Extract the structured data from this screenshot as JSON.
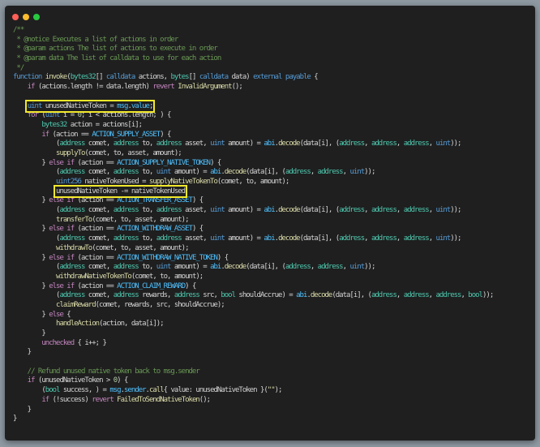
{
  "window": {
    "controls": [
      {
        "name": "close",
        "color": "#ff5f57"
      },
      {
        "name": "minimize",
        "color": "#febc2e"
      },
      {
        "name": "zoom",
        "color": "#28c840"
      }
    ]
  },
  "highlight_color": "#f2e82c",
  "lines": [
    {
      "tokens": [
        [
          "/**",
          "c"
        ]
      ]
    },
    {
      "tokens": [
        [
          " * @notice Executes a list of actions in order",
          "c"
        ]
      ]
    },
    {
      "tokens": [
        [
          " * @param actions The list of actions to execute in order",
          "c"
        ]
      ]
    },
    {
      "tokens": [
        [
          " * @param data The list of calldata to use for each action",
          "c"
        ]
      ]
    },
    {
      "tokens": [
        [
          " */",
          "c"
        ]
      ]
    },
    {
      "tokens": [
        [
          "function",
          "s"
        ],
        " ",
        [
          "invoke",
          "f"
        ],
        "(",
        [
          "bytes32",
          "t"
        ],
        "[] ",
        [
          "calldata",
          "s"
        ],
        " actions, ",
        [
          "bytes",
          "t"
        ],
        "[] ",
        [
          "calldata",
          "s"
        ],
        " data) ",
        [
          "external",
          "s"
        ],
        " ",
        [
          "payable",
          "s"
        ],
        " {"
      ]
    },
    {
      "tokens": [
        "    ",
        [
          "if",
          "k"
        ],
        " (actions.length != data.length) ",
        [
          "revert",
          "k"
        ],
        " ",
        [
          "InvalidArgument",
          "f"
        ],
        "();"
      ]
    },
    {
      "tokens": [
        ""
      ]
    },
    {
      "tokens": [
        "    ",
        {
          "hl": [
            [
              "uint",
              "s"
            ],
            " unusedNativeToken = ",
            [
              "msg",
              "n"
            ],
            ".",
            [
              "value",
              "n"
            ],
            ";"
          ]
        }
      ]
    },
    {
      "tokens": [
        "    ",
        [
          "for",
          "k"
        ],
        " (",
        [
          "uint",
          "s"
        ],
        " i = ",
        [
          "0",
          "num"
        ],
        "; i < actions.length; ) {"
      ]
    },
    {
      "tokens": [
        "        ",
        [
          "bytes32",
          "t"
        ],
        " action = actions[i];"
      ]
    },
    {
      "tokens": [
        "        ",
        [
          "if",
          "k"
        ],
        " (action == ",
        [
          "ACTION_SUPPLY_ASSET",
          "n"
        ],
        ") {"
      ]
    },
    {
      "tokens": [
        "            (",
        [
          "address",
          "t"
        ],
        " comet, ",
        [
          "address",
          "t"
        ],
        " to, ",
        [
          "address",
          "t"
        ],
        " asset, ",
        [
          "uint",
          "s"
        ],
        " amount) = ",
        [
          "abi",
          "n"
        ],
        ".",
        [
          "decode",
          "f"
        ],
        "(data[i], (",
        [
          "address",
          "t"
        ],
        ", ",
        [
          "address",
          "t"
        ],
        ", ",
        [
          "address",
          "t"
        ],
        ", ",
        [
          "uint",
          "s"
        ],
        "));"
      ]
    },
    {
      "tokens": [
        "            ",
        [
          "supplyTo",
          "f"
        ],
        "(comet, to, asset, amount);"
      ]
    },
    {
      "tokens": [
        "        } ",
        [
          "else",
          "k"
        ],
        " ",
        [
          "if",
          "k"
        ],
        " (action == ",
        [
          "ACTION_SUPPLY_NATIVE_TOKEN",
          "n"
        ],
        ") {"
      ]
    },
    {
      "tokens": [
        "            (",
        [
          "address",
          "t"
        ],
        " comet, ",
        [
          "address",
          "t"
        ],
        " to, ",
        [
          "uint",
          "s"
        ],
        " amount) = ",
        [
          "abi",
          "n"
        ],
        ".",
        [
          "decode",
          "f"
        ],
        "(data[i], (",
        [
          "address",
          "t"
        ],
        ", ",
        [
          "address",
          "t"
        ],
        ", ",
        [
          "uint",
          "s"
        ],
        "));"
      ]
    },
    {
      "tokens": [
        "            ",
        [
          "uint256",
          "s"
        ],
        " nativeTokenUsed = ",
        [
          "supplyNativeTokenTo",
          "f"
        ],
        "(comet, to, amount);"
      ]
    },
    {
      "tokens": [
        "            ",
        {
          "hl": [
            "unusedNativeToken -= nativeTokenUsed"
          ]
        }
      ]
    },
    {
      "tokens": [
        "        } ",
        [
          "else",
          "k"
        ],
        " ",
        [
          "if",
          "k"
        ],
        " (action == ",
        [
          "ACTION_TRANSFER_ASSET",
          "n"
        ],
        ") {"
      ]
    },
    {
      "tokens": [
        "            (",
        [
          "address",
          "t"
        ],
        " comet, ",
        [
          "address",
          "t"
        ],
        " to, ",
        [
          "address",
          "t"
        ],
        " asset, ",
        [
          "uint",
          "s"
        ],
        " amount) = ",
        [
          "abi",
          "n"
        ],
        ".",
        [
          "decode",
          "f"
        ],
        "(data[i], (",
        [
          "address",
          "t"
        ],
        ", ",
        [
          "address",
          "t"
        ],
        ", ",
        [
          "address",
          "t"
        ],
        ", ",
        [
          "uint",
          "s"
        ],
        "));"
      ]
    },
    {
      "tokens": [
        "            ",
        [
          "transferTo",
          "f"
        ],
        "(comet, to, asset, amount);"
      ]
    },
    {
      "tokens": [
        "        } ",
        [
          "else",
          "k"
        ],
        " ",
        [
          "if",
          "k"
        ],
        " (action == ",
        [
          "ACTION_WITHDRAW_ASSET",
          "n"
        ],
        ") {"
      ]
    },
    {
      "tokens": [
        "            (",
        [
          "address",
          "t"
        ],
        " comet, ",
        [
          "address",
          "t"
        ],
        " to, ",
        [
          "address",
          "t"
        ],
        " asset, ",
        [
          "uint",
          "s"
        ],
        " amount) = ",
        [
          "abi",
          "n"
        ],
        ".",
        [
          "decode",
          "f"
        ],
        "(data[i], (",
        [
          "address",
          "t"
        ],
        ", ",
        [
          "address",
          "t"
        ],
        ", ",
        [
          "address",
          "t"
        ],
        ", ",
        [
          "uint",
          "s"
        ],
        "));"
      ]
    },
    {
      "tokens": [
        "            ",
        [
          "withdrawTo",
          "f"
        ],
        "(comet, to, asset, amount);"
      ]
    },
    {
      "tokens": [
        "        } ",
        [
          "else",
          "k"
        ],
        " ",
        [
          "if",
          "k"
        ],
        " (action == ",
        [
          "ACTION_WITHDRAW_NATIVE_TOKEN",
          "n"
        ],
        ") {"
      ]
    },
    {
      "tokens": [
        "            (",
        [
          "address",
          "t"
        ],
        " comet, ",
        [
          "address",
          "t"
        ],
        " to, ",
        [
          "uint",
          "s"
        ],
        " amount) = ",
        [
          "abi",
          "n"
        ],
        ".",
        [
          "decode",
          "f"
        ],
        "(data[i], (",
        [
          "address",
          "t"
        ],
        ", ",
        [
          "address",
          "t"
        ],
        ", ",
        [
          "uint",
          "s"
        ],
        "));"
      ]
    },
    {
      "tokens": [
        "            ",
        [
          "withdrawNativeTokenTo",
          "f"
        ],
        "(comet, to, amount);"
      ]
    },
    {
      "tokens": [
        "        } ",
        [
          "else",
          "k"
        ],
        " ",
        [
          "if",
          "k"
        ],
        " (action == ",
        [
          "ACTION_CLAIM_REWARD",
          "n"
        ],
        ") {"
      ]
    },
    {
      "tokens": [
        "            (",
        [
          "address",
          "t"
        ],
        " comet, ",
        [
          "address",
          "t"
        ],
        " rewards, ",
        [
          "address",
          "t"
        ],
        " src, ",
        [
          "bool",
          "t"
        ],
        " shouldAccrue) = ",
        [
          "abi",
          "n"
        ],
        ".",
        [
          "decode",
          "f"
        ],
        "(data[i], (",
        [
          "address",
          "t"
        ],
        ", ",
        [
          "address",
          "t"
        ],
        ", ",
        [
          "address",
          "t"
        ],
        ", ",
        [
          "bool",
          "t"
        ],
        "));"
      ]
    },
    {
      "tokens": [
        "            ",
        [
          "claimReward",
          "f"
        ],
        "(comet, rewards, src, shouldAccrue);"
      ]
    },
    {
      "tokens": [
        "        } ",
        [
          "else",
          "k"
        ],
        " {"
      ]
    },
    {
      "tokens": [
        "            ",
        [
          "handleAction",
          "f"
        ],
        "(action, data[i]);"
      ]
    },
    {
      "tokens": [
        "        }"
      ]
    },
    {
      "tokens": [
        "        ",
        [
          "unchecked",
          "k"
        ],
        " { i++; }"
      ]
    },
    {
      "tokens": [
        "    }"
      ]
    },
    {
      "tokens": [
        ""
      ]
    },
    {
      "tokens": [
        [
          "    // Refund unused native token back to msg.sender",
          "c"
        ]
      ]
    },
    {
      "tokens": [
        "    ",
        [
          "if",
          "k"
        ],
        " (unusedNativeToken > ",
        [
          "0",
          "num"
        ],
        ") {"
      ]
    },
    {
      "tokens": [
        "        (",
        [
          "bool",
          "t"
        ],
        " success, ) = ",
        [
          "msg",
          "n"
        ],
        ".",
        [
          "sender",
          "n"
        ],
        ".",
        [
          "call",
          "f"
        ],
        "{ value: unusedNativeToken }(",
        [
          "\"\"",
          "f"
        ],
        ");"
      ]
    },
    {
      "tokens": [
        "        ",
        [
          "if",
          "k"
        ],
        " (!success) ",
        [
          "revert",
          "k"
        ],
        " ",
        [
          "FailedToSendNativeToken",
          "f"
        ],
        "();"
      ]
    },
    {
      "tokens": [
        "    }"
      ]
    },
    {
      "tokens": [
        "}"
      ]
    }
  ]
}
